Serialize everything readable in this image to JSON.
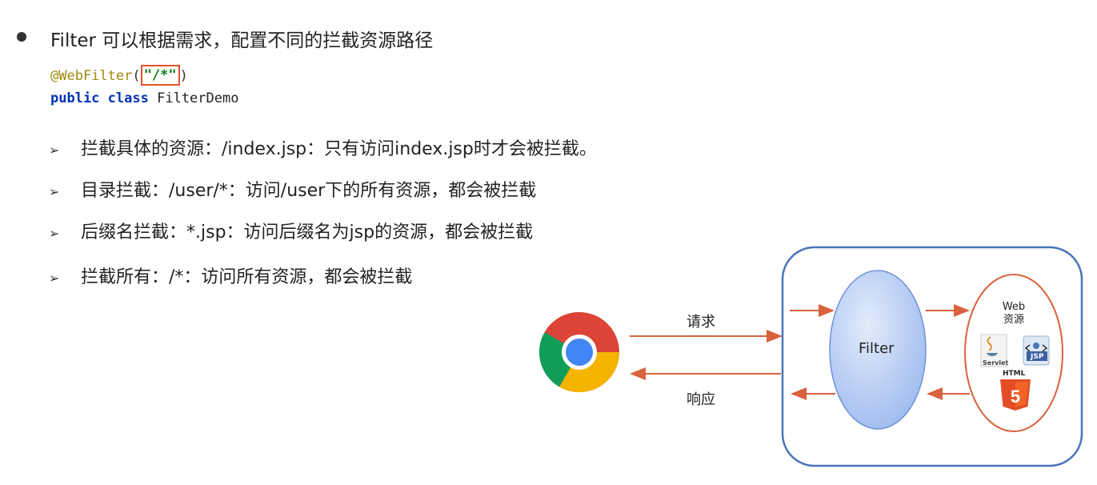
{
  "heading": "Filter 可以根据需求，配置不同的拦截资源路径",
  "code": {
    "annotation": "@WebFilter",
    "open_paren": "(",
    "value": "\"/*\"",
    "close_paren": ")",
    "kw_public": "public",
    "kw_class": "class",
    "class_name": "FilterDemo"
  },
  "items": [
    {
      "arrow": "➢",
      "text": "拦截具体的资源：/index.jsp：只有访问index.jsp时才会被拦截。"
    },
    {
      "arrow": "➢",
      "text": "目录拦截：/user/*：访问/user下的所有资源，都会被拦截"
    },
    {
      "arrow": "➢",
      "text": "后缀名拦截：*.jsp：访问后缀名为jsp的资源，都会被拦截"
    },
    {
      "arrow": "➢",
      "text": "拦截所有：/*：访问所有资源，都会被拦截"
    }
  ],
  "diagram": {
    "request_label": "请求",
    "response_label": "响应",
    "filter_label": "Filter",
    "web_resource_label_1": "Web",
    "web_resource_label_2": "资源",
    "servlet_label": "Servlet",
    "jsp_label": "JSP",
    "html_label": "HTML",
    "html_badge": "5",
    "colors": {
      "arrow": "#d9623e",
      "container_border": "#4a74b8",
      "filter_fill": "#b7cdf3",
      "resources_border": "#d9623e",
      "html5_orange": "#e44d26"
    }
  }
}
